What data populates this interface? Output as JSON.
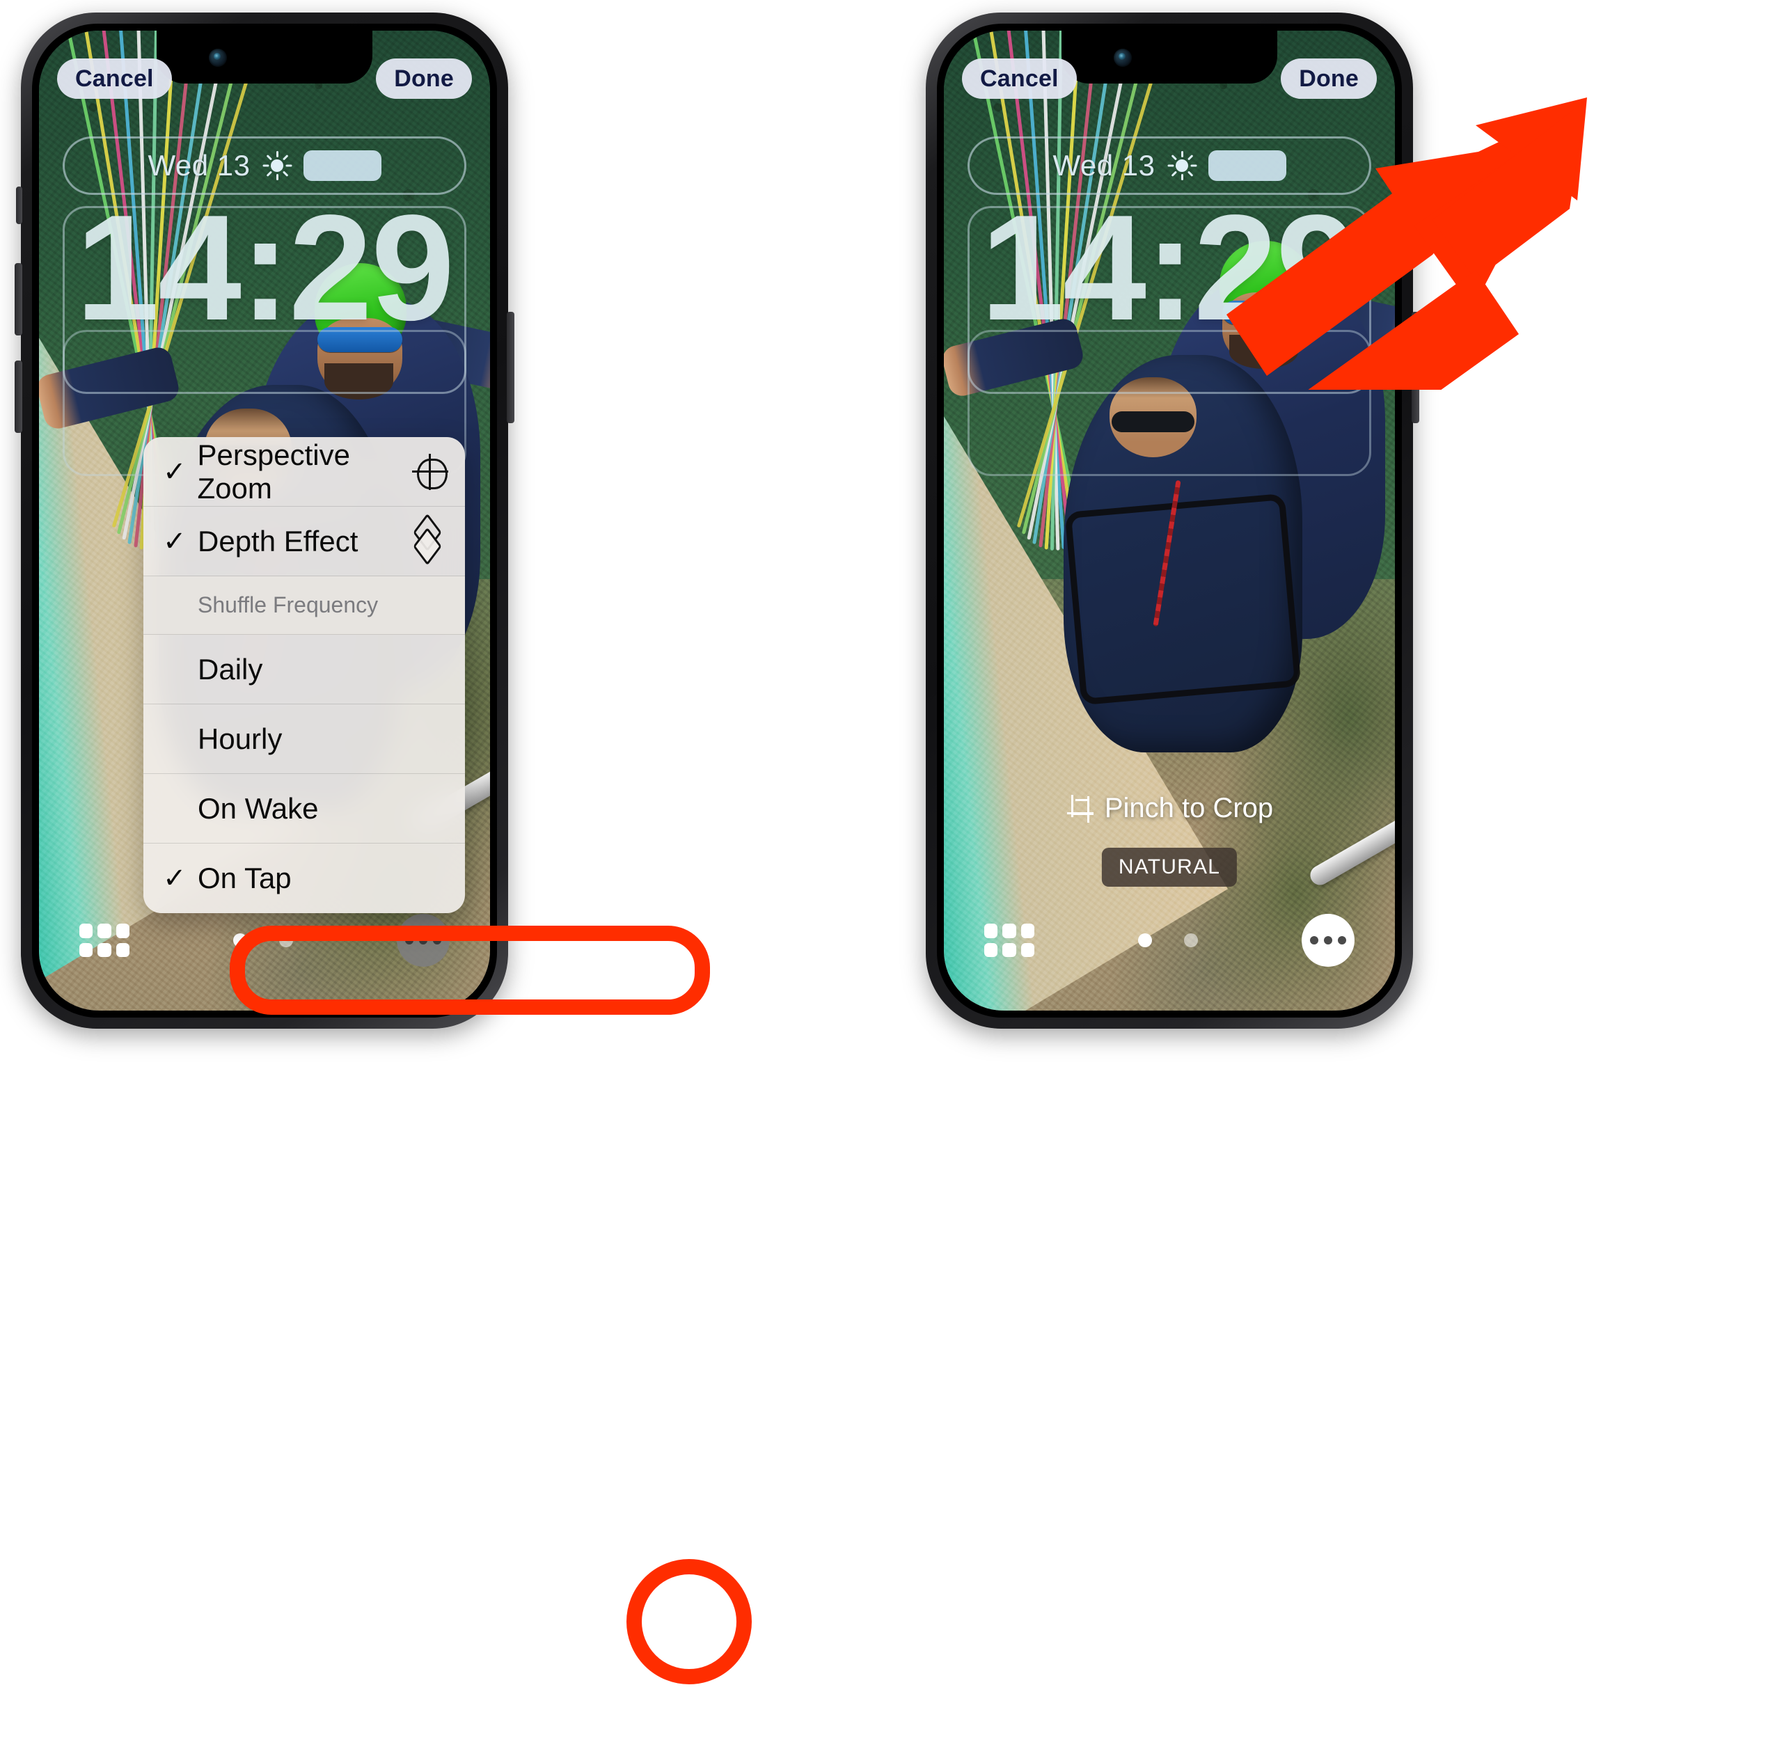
{
  "page": {
    "title": "iOS Lock Screen wallpaper editor — Perspective Zoom toggle",
    "accent_red": "#ff2d00"
  },
  "phones": [
    {
      "id": "left",
      "topbar": {
        "cancel_label": "Cancel",
        "done_label": "Done"
      },
      "status_widget": {
        "date": "Wed 13",
        "weather_icon": "sun-icon",
        "temperature_placeholder": ""
      },
      "clock": "14:29",
      "bottom": {
        "grid_icon": "grid-icon",
        "page_dots": 2,
        "active_dot_index": 0,
        "more_icon": "ellipsis-icon"
      },
      "context_menu": {
        "items": [
          {
            "label": "Perspective Zoom",
            "checked": true,
            "icon": "perspective-zoom-icon",
            "type": "toggle",
            "highlighted": true
          },
          {
            "label": "Depth Effect",
            "checked": true,
            "icon": "depth-effect-icon",
            "type": "toggle",
            "highlighted": false
          },
          {
            "label": "Shuffle Frequency",
            "checked": false,
            "icon": "",
            "type": "section-header",
            "highlighted": false
          },
          {
            "label": "Daily",
            "checked": false,
            "icon": "",
            "type": "option",
            "highlighted": false
          },
          {
            "label": "Hourly",
            "checked": false,
            "icon": "",
            "type": "option",
            "highlighted": false
          },
          {
            "label": "On Wake",
            "checked": false,
            "icon": "",
            "type": "option",
            "highlighted": false
          },
          {
            "label": "On Tap",
            "checked": true,
            "icon": "",
            "type": "option",
            "highlighted": false
          }
        ]
      },
      "annotations": {
        "menu_item_ring": true,
        "more_button_ring": true
      }
    },
    {
      "id": "right",
      "topbar": {
        "cancel_label": "Cancel",
        "done_label": "Done"
      },
      "status_widget": {
        "date": "Wed 13",
        "weather_icon": "sun-icon",
        "temperature_placeholder": ""
      },
      "clock": "14:29",
      "hints": {
        "crop_label": "Pinch to Crop",
        "crop_icon": "crop-icon",
        "style_badge": "NATURAL"
      },
      "bottom": {
        "grid_icon": "grid-icon",
        "page_dots": 2,
        "active_dot_index": 0,
        "more_icon": "ellipsis-icon"
      },
      "annotations": {
        "arrow_to_done": true
      }
    }
  ]
}
